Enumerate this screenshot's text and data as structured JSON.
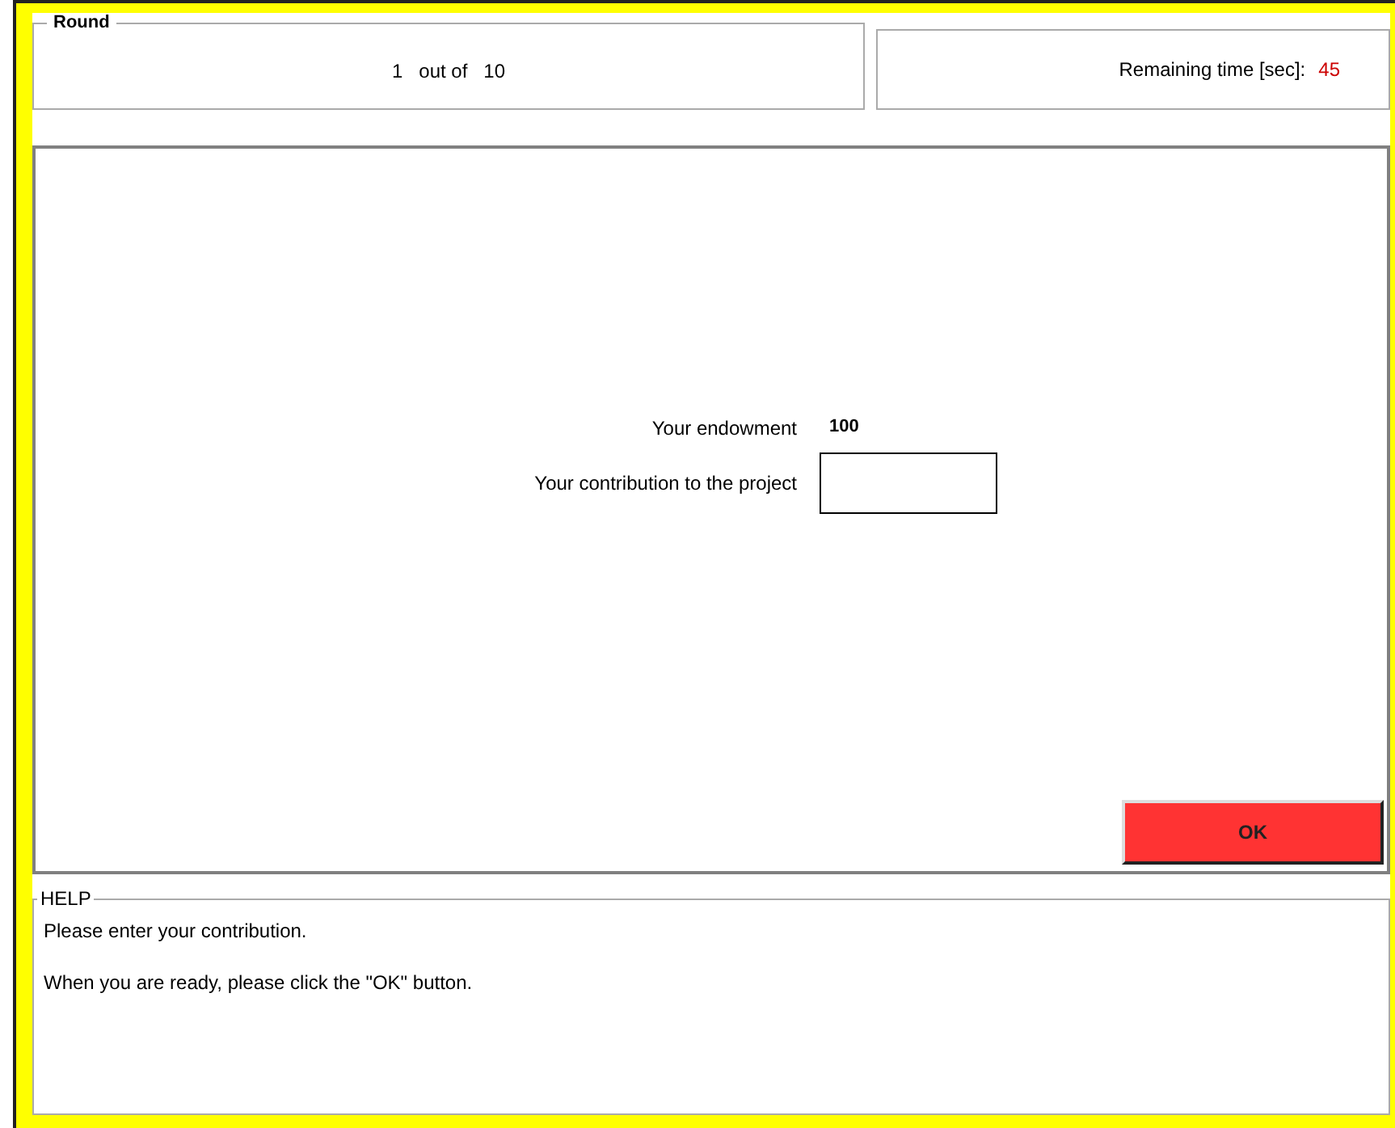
{
  "round": {
    "legend": "Round",
    "current": "1",
    "separator": "out of",
    "total": "10"
  },
  "timer": {
    "label": "Remaining time [sec]:",
    "value": "45"
  },
  "form": {
    "rows": [
      {
        "kind": "value",
        "label": "Your endowment",
        "value": "100"
      },
      {
        "kind": "input",
        "label": "Your contribution to the project"
      }
    ]
  },
  "ok_button": {
    "label": "OK"
  },
  "help": {
    "legend": "HELP",
    "lines": [
      "Please enter your contribution.",
      "When you are ready, please click the \"OK\" button."
    ]
  }
}
